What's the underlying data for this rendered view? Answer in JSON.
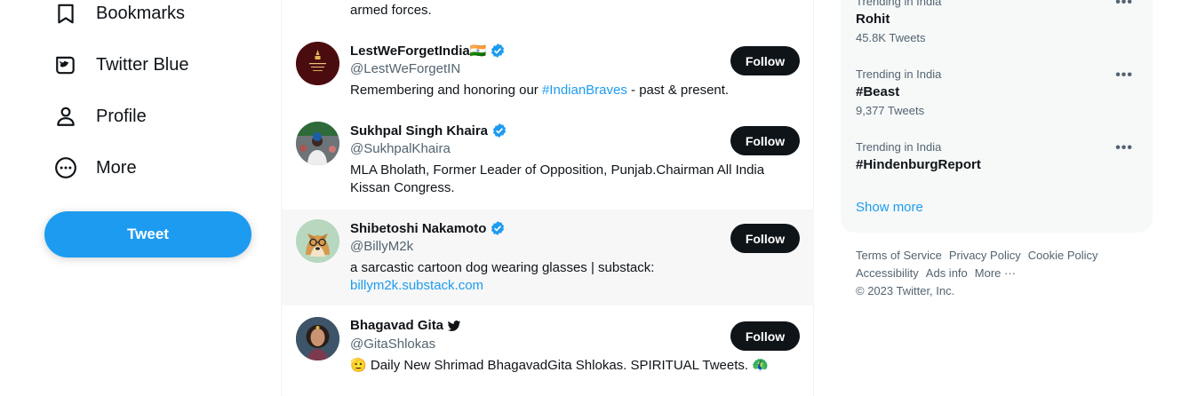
{
  "nav": {
    "items": [
      {
        "label": "Bookmarks",
        "icon": "bookmark-icon"
      },
      {
        "label": "Twitter Blue",
        "icon": "twitter-blue-icon"
      },
      {
        "label": "Profile",
        "icon": "profile-icon"
      },
      {
        "label": "More",
        "icon": "more-circle-icon"
      }
    ],
    "tweet_label": "Tweet"
  },
  "feed": {
    "prev_tail": "armed forces.",
    "follow_label": "Follow",
    "users": [
      {
        "name": "LestWeForgetIndia🇮🇳",
        "handle": "@LestWeForgetIN",
        "bio_before": "Remembering and honoring our ",
        "bio_link": "#IndianBraves",
        "bio_after": " - past & present.",
        "verified": "blue"
      },
      {
        "name": "Sukhpal Singh Khaira",
        "handle": "@SukhpalKhaira",
        "bio_line1": "MLA Bholath, Former Leader of Opposition, Punjab.Chairman All India",
        "bio_line2": "Kissan Congress.",
        "verified": "blue"
      },
      {
        "name": "Shibetoshi Nakamoto",
        "handle": "@BillyM2k",
        "bio_line1": "a sarcastic cartoon dog wearing glasses | substack:",
        "bio_link": "billym2k.substack.com",
        "verified": "blue"
      },
      {
        "name": "Bhagavad Gita",
        "handle": "@GitaShlokas",
        "bio_prefix": "🫡",
        "bio_text": " Daily New Shrimad BhagavadGita Shlokas. SPIRITUAL Tweets. ",
        "bio_suffix": "🦚",
        "verified": "bird"
      }
    ]
  },
  "trends": {
    "items": [
      {
        "context": "Trending in India",
        "title": "Rohit",
        "count": "45.8K Tweets"
      },
      {
        "context": "Trending in India",
        "title": "#Beast",
        "count": "9,377 Tweets"
      },
      {
        "context": "Trending in India",
        "title": "#HindenburgReport",
        "count": ""
      }
    ],
    "more_glyph": "•••",
    "show_more": "Show more"
  },
  "footer": {
    "links": [
      "Terms of Service",
      "Privacy Policy",
      "Cookie Policy",
      "Accessibility",
      "Ads info",
      "More ···"
    ],
    "copyright": "© 2023 Twitter, Inc."
  },
  "colors": {
    "accent": "#1d9bf0",
    "text": "#0f1419",
    "muted": "#536471",
    "panel": "#f7f9f9"
  }
}
